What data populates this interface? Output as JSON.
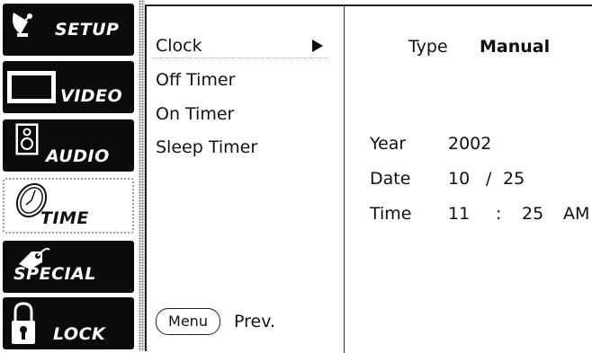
{
  "sidebar": {
    "items": [
      {
        "label": "SETUP",
        "icon": "satellite-dish-icon",
        "active": false
      },
      {
        "label": "VIDEO",
        "icon": "tv-screen-icon",
        "active": false
      },
      {
        "label": "AUDIO",
        "icon": "speaker-icon",
        "active": false
      },
      {
        "label": "TIME",
        "icon": "clock-icon",
        "active": true
      },
      {
        "label": "SPECIAL",
        "icon": "tag-icon",
        "active": false
      },
      {
        "label": "LOCK",
        "icon": "padlock-icon",
        "active": false
      }
    ]
  },
  "submenu": {
    "items": [
      "Clock",
      "Off Timer",
      "On Timer",
      "Sleep Timer"
    ],
    "selected": "Clock"
  },
  "clock": {
    "type_label": "Type",
    "type_value": "Manual",
    "year_label": "Year",
    "year_value": "2002",
    "date_label": "Date",
    "date_month": "10",
    "date_sep": "/",
    "date_day": "25",
    "time_label": "Time",
    "time_hour": "11",
    "time_sep": ":",
    "time_minute": "25",
    "time_ampm": "AM"
  },
  "footer": {
    "menu_label": "Menu",
    "prev_label": "Prev."
  },
  "colors": {
    "tile_bg": "#0b0b0b",
    "active_tile_border": "#9a9a9a"
  }
}
